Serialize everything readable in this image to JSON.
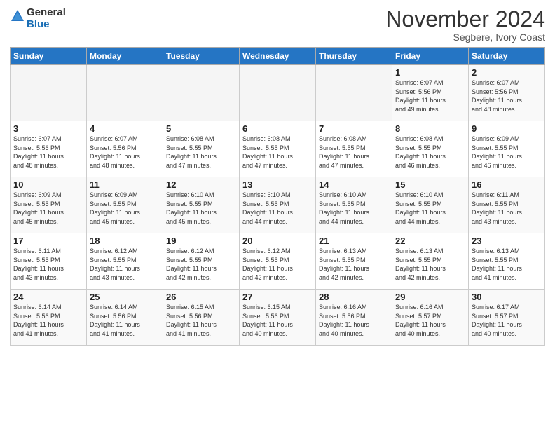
{
  "header": {
    "logo_general": "General",
    "logo_blue": "Blue",
    "month_title": "November 2024",
    "location": "Segbere, Ivory Coast"
  },
  "days_of_week": [
    "Sunday",
    "Monday",
    "Tuesday",
    "Wednesday",
    "Thursday",
    "Friday",
    "Saturday"
  ],
  "weeks": [
    [
      {
        "day": "",
        "info": ""
      },
      {
        "day": "",
        "info": ""
      },
      {
        "day": "",
        "info": ""
      },
      {
        "day": "",
        "info": ""
      },
      {
        "day": "",
        "info": ""
      },
      {
        "day": "1",
        "info": "Sunrise: 6:07 AM\nSunset: 5:56 PM\nDaylight: 11 hours\nand 49 minutes."
      },
      {
        "day": "2",
        "info": "Sunrise: 6:07 AM\nSunset: 5:56 PM\nDaylight: 11 hours\nand 48 minutes."
      }
    ],
    [
      {
        "day": "3",
        "info": "Sunrise: 6:07 AM\nSunset: 5:56 PM\nDaylight: 11 hours\nand 48 minutes."
      },
      {
        "day": "4",
        "info": "Sunrise: 6:07 AM\nSunset: 5:56 PM\nDaylight: 11 hours\nand 48 minutes."
      },
      {
        "day": "5",
        "info": "Sunrise: 6:08 AM\nSunset: 5:55 PM\nDaylight: 11 hours\nand 47 minutes."
      },
      {
        "day": "6",
        "info": "Sunrise: 6:08 AM\nSunset: 5:55 PM\nDaylight: 11 hours\nand 47 minutes."
      },
      {
        "day": "7",
        "info": "Sunrise: 6:08 AM\nSunset: 5:55 PM\nDaylight: 11 hours\nand 47 minutes."
      },
      {
        "day": "8",
        "info": "Sunrise: 6:08 AM\nSunset: 5:55 PM\nDaylight: 11 hours\nand 46 minutes."
      },
      {
        "day": "9",
        "info": "Sunrise: 6:09 AM\nSunset: 5:55 PM\nDaylight: 11 hours\nand 46 minutes."
      }
    ],
    [
      {
        "day": "10",
        "info": "Sunrise: 6:09 AM\nSunset: 5:55 PM\nDaylight: 11 hours\nand 45 minutes."
      },
      {
        "day": "11",
        "info": "Sunrise: 6:09 AM\nSunset: 5:55 PM\nDaylight: 11 hours\nand 45 minutes."
      },
      {
        "day": "12",
        "info": "Sunrise: 6:10 AM\nSunset: 5:55 PM\nDaylight: 11 hours\nand 45 minutes."
      },
      {
        "day": "13",
        "info": "Sunrise: 6:10 AM\nSunset: 5:55 PM\nDaylight: 11 hours\nand 44 minutes."
      },
      {
        "day": "14",
        "info": "Sunrise: 6:10 AM\nSunset: 5:55 PM\nDaylight: 11 hours\nand 44 minutes."
      },
      {
        "day": "15",
        "info": "Sunrise: 6:10 AM\nSunset: 5:55 PM\nDaylight: 11 hours\nand 44 minutes."
      },
      {
        "day": "16",
        "info": "Sunrise: 6:11 AM\nSunset: 5:55 PM\nDaylight: 11 hours\nand 43 minutes."
      }
    ],
    [
      {
        "day": "17",
        "info": "Sunrise: 6:11 AM\nSunset: 5:55 PM\nDaylight: 11 hours\nand 43 minutes."
      },
      {
        "day": "18",
        "info": "Sunrise: 6:12 AM\nSunset: 5:55 PM\nDaylight: 11 hours\nand 43 minutes."
      },
      {
        "day": "19",
        "info": "Sunrise: 6:12 AM\nSunset: 5:55 PM\nDaylight: 11 hours\nand 42 minutes."
      },
      {
        "day": "20",
        "info": "Sunrise: 6:12 AM\nSunset: 5:55 PM\nDaylight: 11 hours\nand 42 minutes."
      },
      {
        "day": "21",
        "info": "Sunrise: 6:13 AM\nSunset: 5:55 PM\nDaylight: 11 hours\nand 42 minutes."
      },
      {
        "day": "22",
        "info": "Sunrise: 6:13 AM\nSunset: 5:55 PM\nDaylight: 11 hours\nand 42 minutes."
      },
      {
        "day": "23",
        "info": "Sunrise: 6:13 AM\nSunset: 5:55 PM\nDaylight: 11 hours\nand 41 minutes."
      }
    ],
    [
      {
        "day": "24",
        "info": "Sunrise: 6:14 AM\nSunset: 5:56 PM\nDaylight: 11 hours\nand 41 minutes."
      },
      {
        "day": "25",
        "info": "Sunrise: 6:14 AM\nSunset: 5:56 PM\nDaylight: 11 hours\nand 41 minutes."
      },
      {
        "day": "26",
        "info": "Sunrise: 6:15 AM\nSunset: 5:56 PM\nDaylight: 11 hours\nand 41 minutes."
      },
      {
        "day": "27",
        "info": "Sunrise: 6:15 AM\nSunset: 5:56 PM\nDaylight: 11 hours\nand 40 minutes."
      },
      {
        "day": "28",
        "info": "Sunrise: 6:16 AM\nSunset: 5:56 PM\nDaylight: 11 hours\nand 40 minutes."
      },
      {
        "day": "29",
        "info": "Sunrise: 6:16 AM\nSunset: 5:57 PM\nDaylight: 11 hours\nand 40 minutes."
      },
      {
        "day": "30",
        "info": "Sunrise: 6:17 AM\nSunset: 5:57 PM\nDaylight: 11 hours\nand 40 minutes."
      }
    ]
  ]
}
